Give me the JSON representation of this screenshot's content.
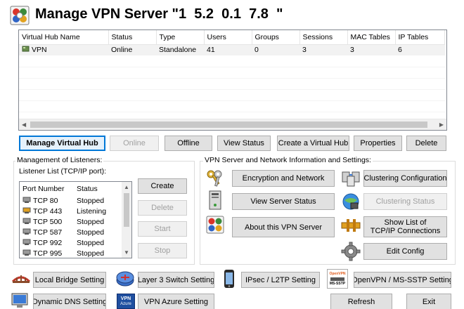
{
  "window": {
    "title": "Manage VPN Server \"1  5.2  0.1  7.8  \""
  },
  "hub_table": {
    "columns": [
      "Virtual Hub Name",
      "Status",
      "Type",
      "Users",
      "Groups",
      "Sessions",
      "MAC Tables",
      "IP Tables"
    ],
    "rows": [
      {
        "name": "VPN",
        "status": "Online",
        "type": "Standalone",
        "users": "41",
        "groups": "0",
        "sessions": "3",
        "mac": "3",
        "ip": "6"
      }
    ]
  },
  "hub_buttons": {
    "manage": "Manage Virtual Hub",
    "online": "Online",
    "offline": "Offline",
    "view_status": "View Status",
    "create": "Create a Virtual Hub",
    "properties": "Properties",
    "delete": "Delete"
  },
  "listeners": {
    "group_title": "Management of Listeners:",
    "list_label": "Listener List (TCP/IP port):",
    "columns": [
      "Port Number",
      "Status"
    ],
    "rows": [
      {
        "port": "TCP 80",
        "status": "Stopped",
        "icon": "stopped-port-icon"
      },
      {
        "port": "TCP 443",
        "status": "Listening",
        "icon": "listening-port-icon"
      },
      {
        "port": "TCP 500",
        "status": "Stopped",
        "icon": "stopped-port-icon"
      },
      {
        "port": "TCP 587",
        "status": "Stopped",
        "icon": "stopped-port-icon"
      },
      {
        "port": "TCP 992",
        "status": "Stopped",
        "icon": "stopped-port-icon"
      },
      {
        "port": "TCP 995",
        "status": "Stopped",
        "icon": "stopped-port-icon"
      }
    ],
    "buttons": {
      "create": "Create",
      "delete": "Delete",
      "start": "Start",
      "stop": "Stop"
    }
  },
  "server_info": {
    "group_title": "VPN Server and Network Information and Settings:",
    "encryption": "Encryption and Network",
    "server_status": "View Server Status",
    "about": "About this VPN Server",
    "clustering_config": "Clustering Configuration",
    "clustering_status": "Clustering Status",
    "tcpip_line1": "Show List of",
    "tcpip_line2": "TCP/IP Connections",
    "edit_config": "Edit Config"
  },
  "bottom": {
    "local_bridge": "Local Bridge Setting",
    "l3_switch": "Layer 3 Switch Setting",
    "ipsec": "IPsec / L2TP Setting",
    "openvpn": "OpenVPN / MS-SSTP Setting",
    "ddns": "Dynamic DNS Setting",
    "azure": "VPN Azure Setting",
    "refresh": "Refresh",
    "exit": "Exit",
    "openvpn_icon_text": "OpenVPN",
    "mssstp_icon_text": "MS-SSTP",
    "azure_icon_line1": "VPN",
    "azure_icon_line2": "Azure"
  },
  "colors": {
    "accent": "#0078d7",
    "button_bg": "#e1e1e1",
    "disabled_text": "#a0a0a0"
  }
}
